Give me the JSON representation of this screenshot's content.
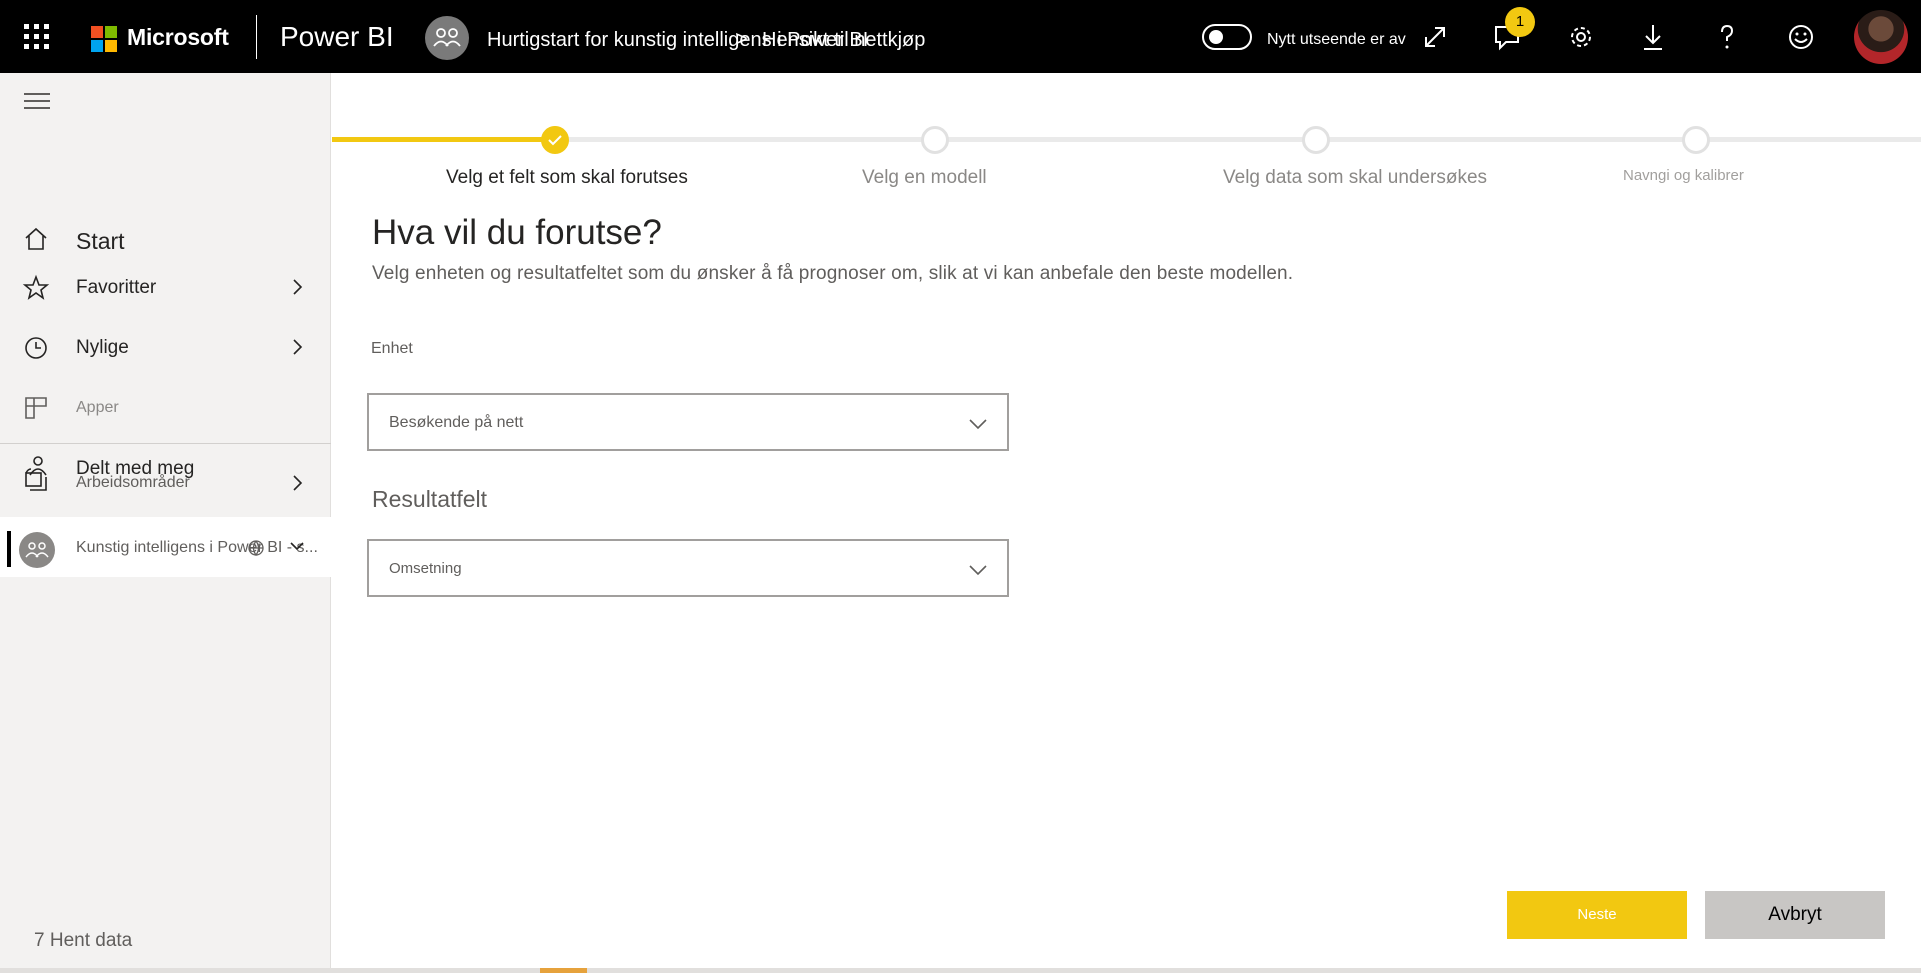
{
  "header": {
    "brand": "Microsoft",
    "product": "Power BI",
    "breadcrumb_workspace": "Hurtigstart for kunstig intelligens i Power BI",
    "breadcrumb_separator": ">",
    "breadcrumb_item": "Hensikt til nettkjøp",
    "toggle_label": "Nytt utseende er av",
    "notification_count": "1",
    "brand_colors": [
      "#f25022",
      "#7fba00",
      "#00a4ef",
      "#ffb900"
    ]
  },
  "sidebar": {
    "items": [
      {
        "label": "Start",
        "icon": "home-icon"
      },
      {
        "label": "Favoritter",
        "icon": "star-icon"
      },
      {
        "label": "Nylige",
        "icon": "clock-icon"
      },
      {
        "label": "Apper",
        "icon": "apps-icon"
      },
      {
        "label": "Delt med meg",
        "icon": "shared-icon"
      },
      {
        "label": "Arbeidsområder",
        "icon": "workspaces-icon"
      }
    ],
    "current_workspace": "Kunstig intelligens i Power BI - s...",
    "get_data": "7 Hent data"
  },
  "stepper": {
    "steps": [
      {
        "label": "Velg et felt som skal forutses",
        "state": "done"
      },
      {
        "label": "Velg en modell",
        "state": "pending"
      },
      {
        "label": "Velg data som skal undersøkes",
        "state": "pending"
      },
      {
        "label": "Navngi og kalibrer",
        "state": "pending"
      }
    ],
    "accent": "#f2c811"
  },
  "form": {
    "title": "Hva vil du forutse?",
    "description": "Velg enheten og resultatfeltet som du ønsker å få prognoser om, slik at vi kan anbefale den beste modellen.",
    "entity_label": "Enhet",
    "entity_value": "Besøkende på nett",
    "outcome_title": "Resultatfelt",
    "outcome_value": "Omsetning"
  },
  "buttons": {
    "next": "Neste",
    "cancel": "Avbryt"
  }
}
